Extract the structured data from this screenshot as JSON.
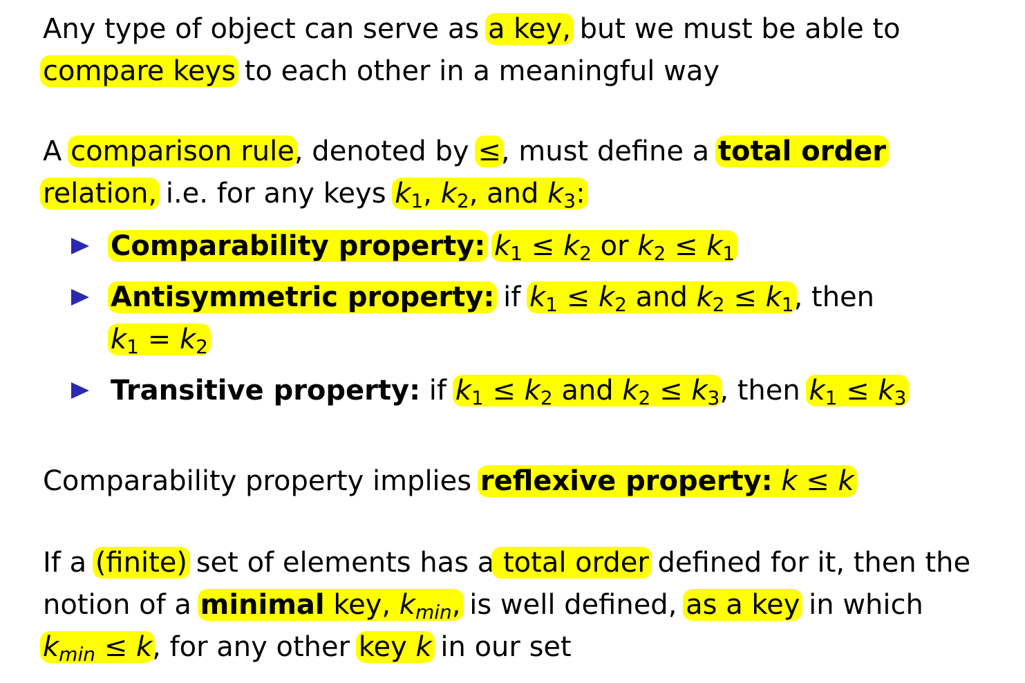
{
  "p1": {
    "l1_a": "Any type of object can serve as ",
    "l1_hl": "a key,",
    "l1_b": " but we must be able to",
    "l2_hl": "compare keys",
    "l2_b": " to each other in a meaningful way"
  },
  "p2": {
    "l1_a": "A ",
    "l1_hl1": "comparison rule",
    "l1_b": ", denoted by ",
    "l1_hl2": "≤",
    "l1_c": ", must define a ",
    "l1_hl3": "total order",
    "l2_hl": "relation,",
    "l2_b": " i.e. for any keys ",
    "l2_math_k1": "k",
    "l2_sub1": "1",
    "l2_comma1": ", ",
    "l2_math_k2": "k",
    "l2_sub2": "2",
    "l2_and": ", and ",
    "l2_math_k3": "k",
    "l2_sub3": "3",
    "l2_colon": ":"
  },
  "bullets": {
    "b1_title": "Comparability property:",
    "b1_expr_a": "k",
    "b1_s1": "1",
    "b1_le1": " ≤ ",
    "b1_expr_b": "k",
    "b1_s2": "2",
    "b1_or": " or ",
    "b1_expr_c": "k",
    "b1_s3": "2",
    "b1_le2": " ≤ ",
    "b1_expr_d": "k",
    "b1_s4": "1",
    "b2_title": "Antisymmetric property:",
    "b2_if": " if ",
    "b2_e1": "k",
    "b2_s1": "1",
    "b2_le1": " ≤ ",
    "b2_e2": "k",
    "b2_s2": "2",
    "b2_and": " and ",
    "b2_e3": "k",
    "b2_s3": "2",
    "b2_le2": " ≤ ",
    "b2_e4": "k",
    "b2_s4": "1",
    "b2_then": ", then",
    "b2_e5": "k",
    "b2_s5": "1",
    "b2_eq": " = ",
    "b2_e6": "k",
    "b2_s6": "2",
    "b3_title": "Transitive property:",
    "b3_if": " if ",
    "b3_e1": "k",
    "b3_s1": "1",
    "b3_le1": " ≤ ",
    "b3_e2": "k",
    "b3_s2": "2",
    "b3_and": " and ",
    "b3_e3": "k",
    "b3_s3": "2",
    "b3_le2": " ≤ ",
    "b3_e4": "k",
    "b3_s4": "3",
    "b3_then": ", then ",
    "b3_e5": "k",
    "b3_s5": "1",
    "b3_le3": " ≤ ",
    "b3_e6": "k",
    "b3_s6": "3"
  },
  "p3": {
    "a": "Comparability property implies ",
    "hl_bold": "reflexive property:",
    "expr_k1": "k",
    "le": " ≤ ",
    "expr_k2": "k"
  },
  "p4": {
    "l1_a": "If a ",
    "l1_hl1": "(finite)",
    "l1_b": " set of elements has a",
    "l1_hl2": " total order",
    "l1_c": " defined for it, then the",
    "l2_a": "notion of a ",
    "l2_hl1_bold": "minimal",
    "l2_hl1_rest": " key, ",
    "l2_kmin_k": "k",
    "l2_kmin_sub": "min",
    "l2_hl1_comma": ",",
    "l2_b": " is well defined, ",
    "l2_hl2": "as a key",
    "l2_c": " in which",
    "l3_k": "k",
    "l3_sub": "min",
    "l3_le": " ≤ ",
    "l3_k2": "k",
    "l3_a": ", for any other ",
    "l3_hl_key": "key ",
    "l3_hl_k": "k",
    "l3_b": " in our set"
  },
  "colors": {
    "highlight": "#ffff00",
    "bullet": "#2a2ab0",
    "text": "#000000"
  }
}
